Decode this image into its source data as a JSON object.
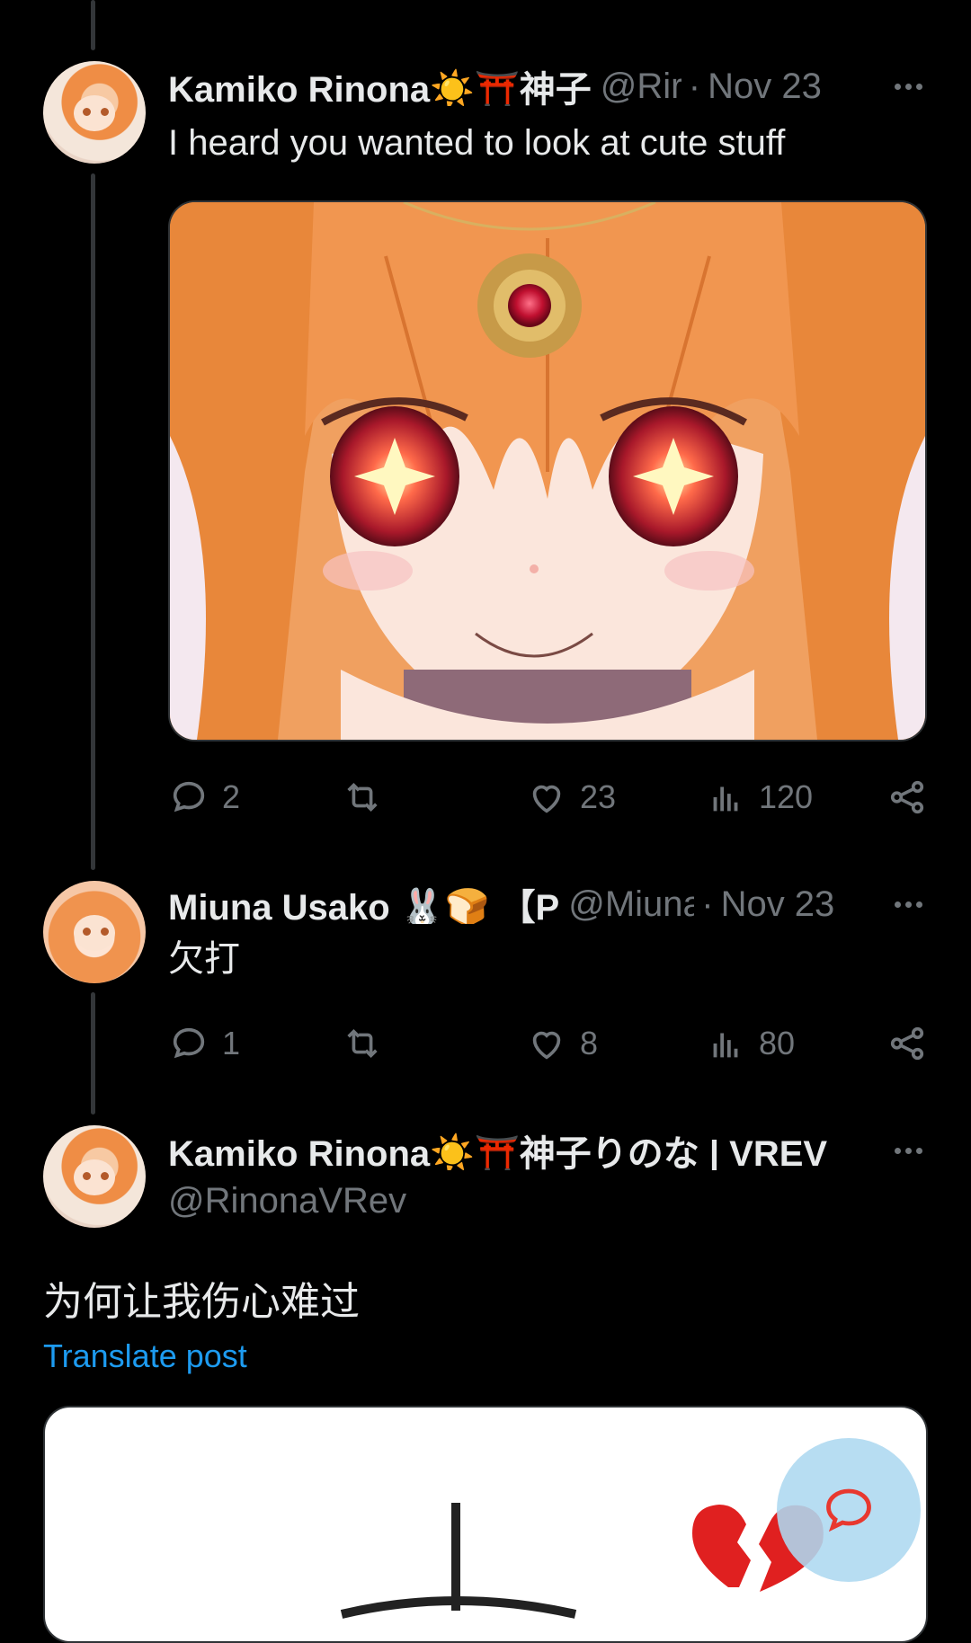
{
  "posts": [
    {
      "author_name": "Kamiko Rinona☀️⛩️神子",
      "handle": "@Rir",
      "separator": "·",
      "date": "Nov 23",
      "text": "I heard you wanted to look at cute stuff",
      "media_description": "",
      "stats": {
        "replies": "2",
        "reposts": "",
        "likes": "23",
        "views": "120"
      }
    },
    {
      "author_name": "Miuna Usako 🐰🍞 【P",
      "handle": "@Miuna",
      "separator": "·",
      "date": "Nov 23",
      "text": "欠打",
      "stats": {
        "replies": "1",
        "reposts": "",
        "likes": "8",
        "views": "80"
      }
    },
    {
      "author_name": "Kamiko Rinona☀️⛩️神子りのな | VREV",
      "handle": "@RinonaVRev",
      "text": "为何让我伤心难过",
      "translate_label": "Translate post"
    }
  ],
  "colors": {
    "background": "#000000",
    "text_primary": "#e7e9ea",
    "text_secondary": "#71767b",
    "link": "#1d9bf0",
    "fab": "#add8f0"
  }
}
